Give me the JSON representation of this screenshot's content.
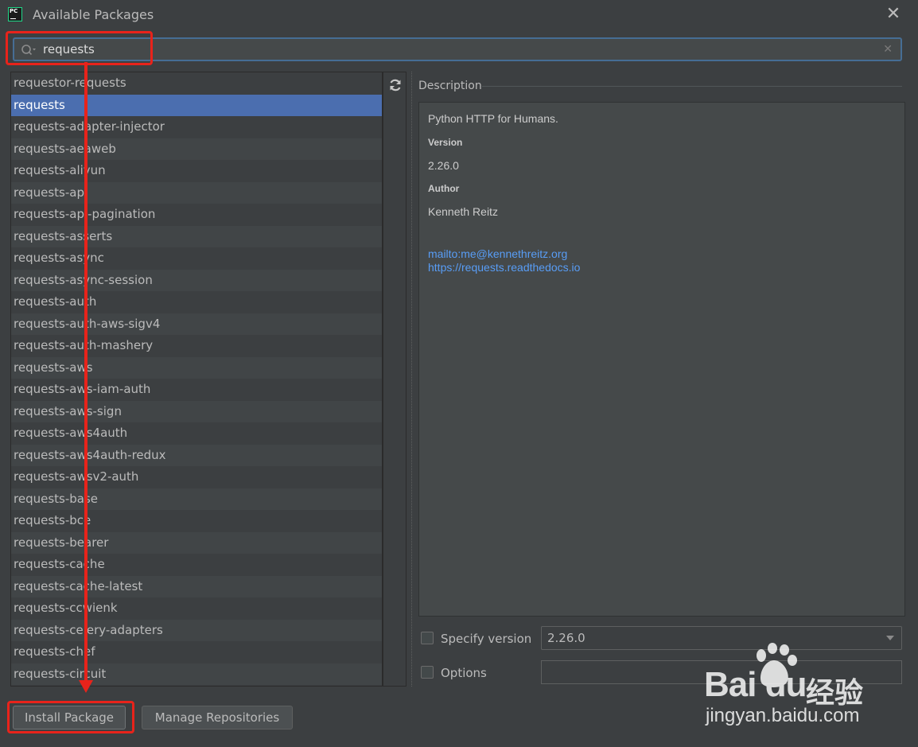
{
  "window": {
    "title": "Available Packages",
    "icon_text": "PC"
  },
  "search": {
    "value": "requests",
    "placeholder": ""
  },
  "packages": [
    "requestor-requests",
    "requests",
    "requests-adapter-injector",
    "requests-aeaweb",
    "requests-aliyun",
    "requests-api",
    "requests-api-pagination",
    "requests-asserts",
    "requests-async",
    "requests-async-session",
    "requests-auth",
    "requests-auth-aws-sigv4",
    "requests-auth-mashery",
    "requests-aws",
    "requests-aws-iam-auth",
    "requests-aws-sign",
    "requests-aws4auth",
    "requests-aws4auth-redux",
    "requests-awsv2-auth",
    "requests-base",
    "requests-bce",
    "requests-bearer",
    "requests-cache",
    "requests-cache-latest",
    "requests-ccwienk",
    "requests-celery-adapters",
    "requests-chef",
    "requests-circuit"
  ],
  "selected_package": "requests",
  "description": {
    "label": "Description",
    "summary": "Python HTTP for Humans.",
    "version_heading": "Version",
    "version": "2.26.0",
    "author_heading": "Author",
    "author": "Kenneth Reitz",
    "links": [
      "mailto:me@kennethreitz.org",
      "https://requests.readthedocs.io"
    ]
  },
  "specify_version": {
    "label": "Specify version",
    "checked": false,
    "value": "2.26.0"
  },
  "options": {
    "label": "Options",
    "checked": false,
    "value": ""
  },
  "buttons": {
    "install": "Install Package",
    "manage": "Manage Repositories"
  },
  "watermark": {
    "brand": "Bai du",
    "cn": "经验",
    "url": "jingyan.baidu.com"
  },
  "colors": {
    "background": "#3c3f41",
    "selection": "#4b6eaf",
    "link": "#589df6",
    "annotation": "#e8231b"
  }
}
